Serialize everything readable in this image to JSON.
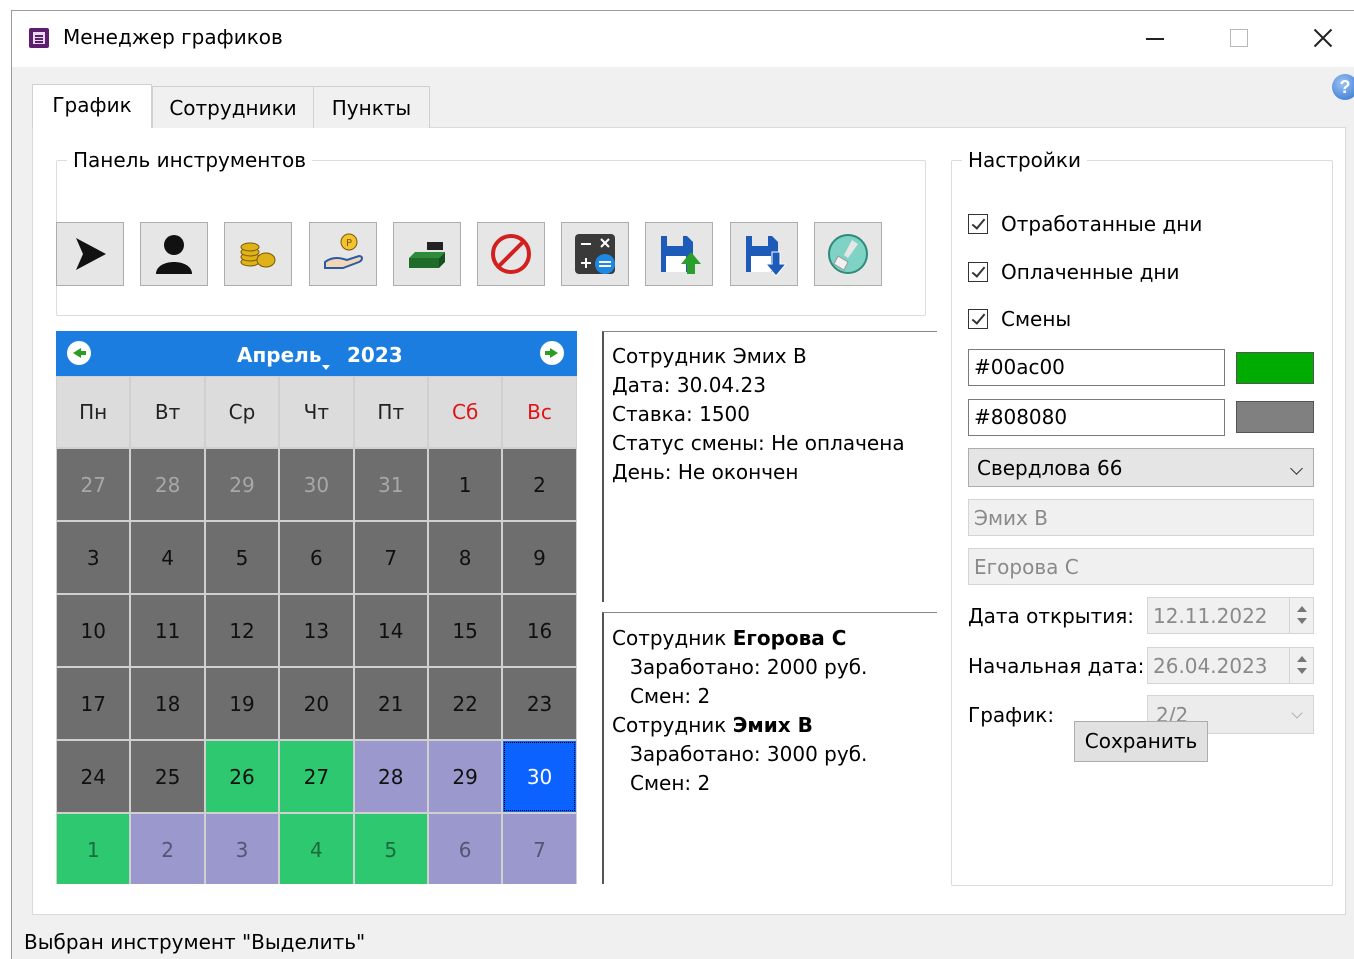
{
  "window": {
    "title": "Менеджер графиков"
  },
  "tabs": [
    {
      "label": "График"
    },
    {
      "label": "Сотрудники"
    },
    {
      "label": "Пункты"
    }
  ],
  "toolbar": {
    "title": "Панель инструментов",
    "tools": [
      {
        "icon": "cursor-arrow-icon"
      },
      {
        "icon": "person-icon"
      },
      {
        "icon": "coins-icon"
      },
      {
        "icon": "hand-coin-payment-icon"
      },
      {
        "icon": "cash-stack-icon"
      },
      {
        "icon": "prohibited-icon"
      },
      {
        "icon": "calculator-icon"
      },
      {
        "icon": "save-upload-icon"
      },
      {
        "icon": "save-download-icon"
      },
      {
        "icon": "clear-brush-icon"
      }
    ]
  },
  "calendar": {
    "month": "Апрель",
    "year": "2023",
    "weekdays": [
      "Пн",
      "Вт",
      "Ср",
      "Чт",
      "Пт",
      "Сб",
      "Вс"
    ],
    "weeks": [
      [
        {
          "d": "27",
          "s": "other"
        },
        {
          "d": "28",
          "s": "other"
        },
        {
          "d": "29",
          "s": "other"
        },
        {
          "d": "30",
          "s": "other"
        },
        {
          "d": "31",
          "s": "other"
        },
        {
          "d": "1",
          "s": "gray"
        },
        {
          "d": "2",
          "s": "gray"
        }
      ],
      [
        {
          "d": "3",
          "s": "gray"
        },
        {
          "d": "4",
          "s": "gray"
        },
        {
          "d": "5",
          "s": "gray"
        },
        {
          "d": "6",
          "s": "gray"
        },
        {
          "d": "7",
          "s": "gray"
        },
        {
          "d": "8",
          "s": "gray"
        },
        {
          "d": "9",
          "s": "gray"
        }
      ],
      [
        {
          "d": "10",
          "s": "gray"
        },
        {
          "d": "11",
          "s": "gray"
        },
        {
          "d": "12",
          "s": "gray"
        },
        {
          "d": "13",
          "s": "gray"
        },
        {
          "d": "14",
          "s": "gray"
        },
        {
          "d": "15",
          "s": "gray"
        },
        {
          "d": "16",
          "s": "gray"
        }
      ],
      [
        {
          "d": "17",
          "s": "gray"
        },
        {
          "d": "18",
          "s": "gray"
        },
        {
          "d": "19",
          "s": "gray"
        },
        {
          "d": "20",
          "s": "gray"
        },
        {
          "d": "21",
          "s": "gray"
        },
        {
          "d": "22",
          "s": "gray"
        },
        {
          "d": "23",
          "s": "gray"
        }
      ],
      [
        {
          "d": "24",
          "s": "gray"
        },
        {
          "d": "25",
          "s": "gray"
        },
        {
          "d": "26",
          "s": "green"
        },
        {
          "d": "27",
          "s": "green"
        },
        {
          "d": "28",
          "s": "purple"
        },
        {
          "d": "29",
          "s": "purple"
        },
        {
          "d": "30",
          "s": "selected"
        }
      ],
      [
        {
          "d": "1",
          "s": "next-green"
        },
        {
          "d": "2",
          "s": "next-purple"
        },
        {
          "d": "3",
          "s": "next-purple"
        },
        {
          "d": "4",
          "s": "next-green"
        },
        {
          "d": "5",
          "s": "next-green"
        },
        {
          "d": "6",
          "s": "next-purple"
        },
        {
          "d": "7",
          "s": "next-purple"
        }
      ]
    ]
  },
  "day_info": {
    "employee": "Сотрудник Эмих В",
    "date": "Дата: 30.04.23",
    "rate": "Ставка: 1500",
    "shift_status": "Статус смены: Не оплачена",
    "day": "День: Не окончен"
  },
  "summary": {
    "prefix": "Сотрудник",
    "employees": [
      {
        "name": "Егорова С",
        "earned": "Заработано: 2000 руб.",
        "shifts": "Смен: 2"
      },
      {
        "name": "Эмих В",
        "earned": "Заработано: 3000 руб.",
        "shifts": "Смен: 2"
      }
    ]
  },
  "settings": {
    "title": "Настройки",
    "worked_days_label": "Отработанные дни",
    "paid_days_label": "Оплаченные дни",
    "shifts_label": "Смены",
    "color1": "#00ac00",
    "color2": "#808080",
    "location": "Свердлова 66",
    "employee1": "Эмих В",
    "employee2": "Егорова С",
    "open_date_label": "Дата открытия:",
    "open_date": "12.11.2022",
    "start_date_label": "Начальная дата:",
    "start_date": "26.04.2023",
    "schedule_label": "График:",
    "schedule": "2/2",
    "save_label": "Сохранить"
  },
  "status_bar": {
    "text": "Выбран инструмент \"Выделить\""
  }
}
